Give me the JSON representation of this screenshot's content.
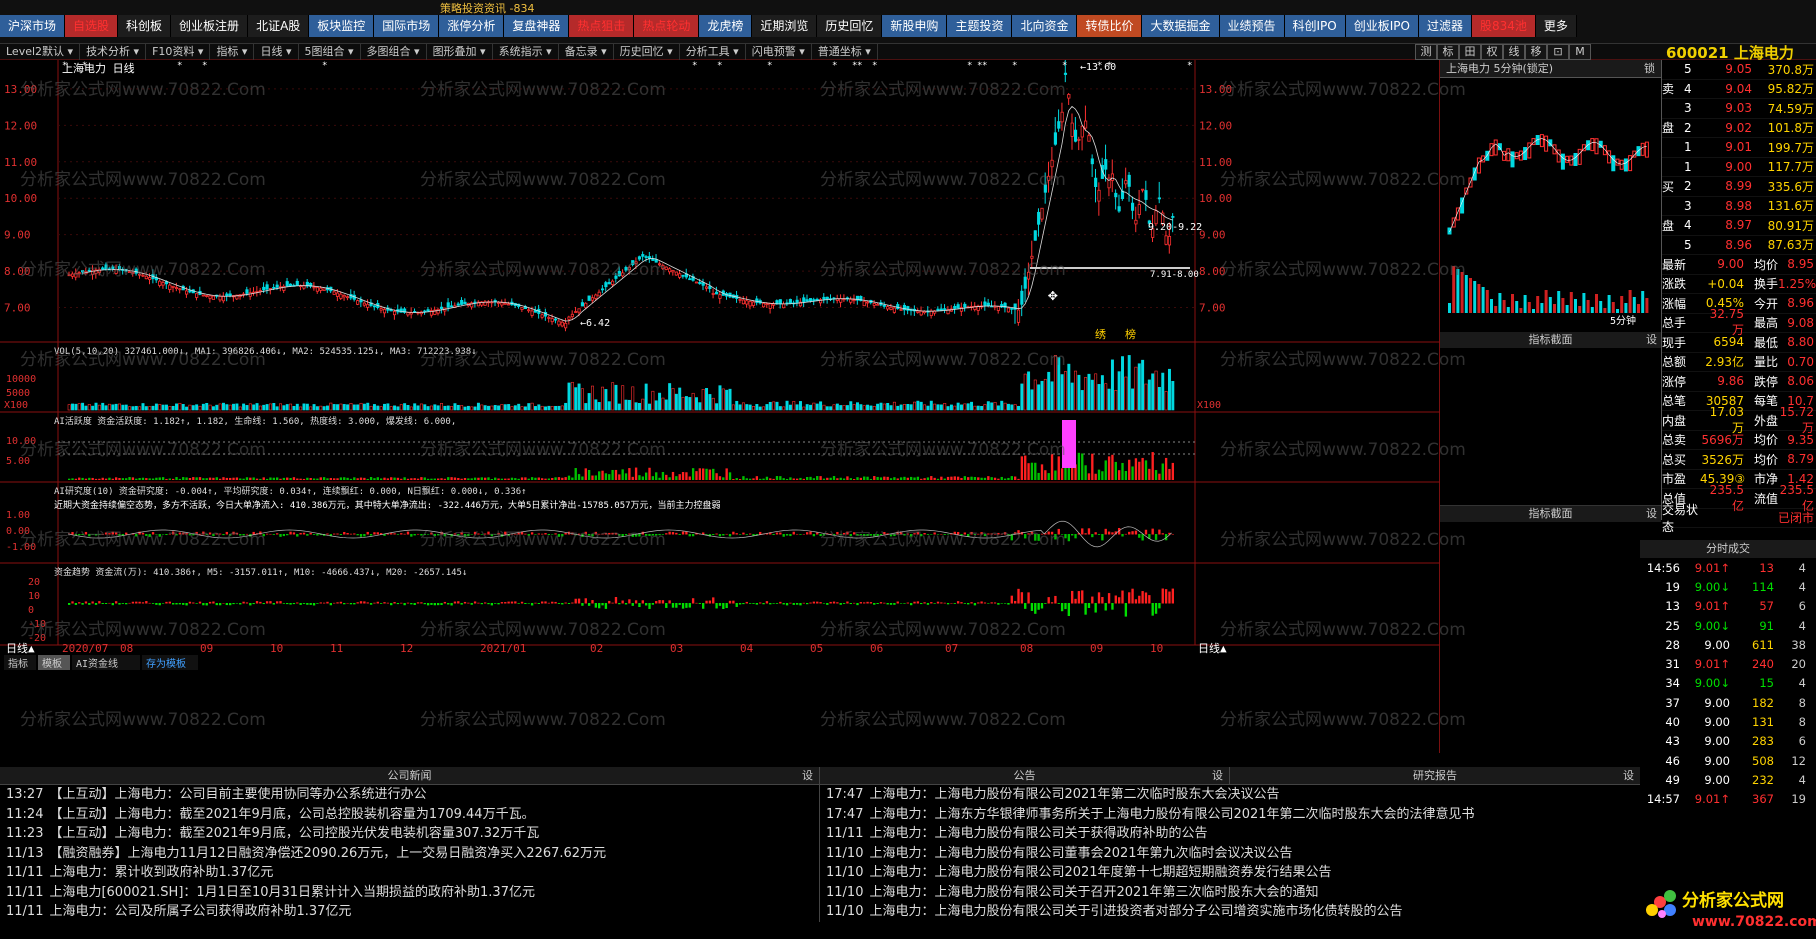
{
  "top": {
    "title_text": "策略投资资讯 -834",
    "menu": [
      "沪深市场",
      "自选股",
      "科创板",
      "创业板注册",
      "北证A股",
      "板块监控",
      "国际市场",
      "涨停分析",
      "复盘神器",
      "热点狙击",
      "热点轮动",
      "龙虎榜",
      "近期浏览",
      "历史回忆",
      "新股申购",
      "主题投资",
      "北向资金",
      "转债比价",
      "大数据掘金",
      "业绩预告",
      "科创IPO",
      "创业板IPO",
      "过滤器",
      "股834池",
      "更多"
    ]
  },
  "toolbar": [
    "Level2默认",
    "技术分析",
    "F10资料",
    "指标",
    "日线",
    "5图组合",
    "多图组合",
    "图形叠加",
    "系统指示",
    "备忘录",
    "历史回忆",
    "分析工具",
    "闪电预警",
    "普通坐标"
  ],
  "right_buttons": [
    "测",
    "标",
    "田",
    "权",
    "线",
    "移",
    "⊡",
    "M"
  ],
  "stock": {
    "code": "600021",
    "name": "上海电力"
  },
  "chart": {
    "title": "上海电力 日线",
    "price_high_label": "13.60",
    "price_low_label": "6.42",
    "last_label_1": "9.20-9.22",
    "last_label_2": "7.91-8.00",
    "y_ticks": [
      "13.00",
      "12.00",
      "11.00",
      "10.00",
      "9.00",
      "8.00",
      "7.00"
    ],
    "vol_line": "VOL(5,10,20)  327461.000↓, MA1: 396826.406↓, MA2: 524535.125↓, MA3: 712223.938↓",
    "vol_ticks": [
      "10000",
      "5000"
    ],
    "vol_unit": "X100",
    "ai1": "AI活跃度 资金活跃度: 1.182↑, 1.182, 生命线: 1.560, 热度线: 3.000, 爆发线: 6.000,",
    "ai1_ticks": [
      "10.00",
      "5.00"
    ],
    "ai2": "AI研究度(10) 资金研究度: -0.004↑, 平均研究度: 0.034↑, 连续飘红: 0.000, N日飘红: 0.000↓, 0.336↑",
    "ai2_note": "近期大资金持续偏空态势，多方不活跃，今日大单净流入: 410.386万元，其中特大单净流出: -322.446万元，大单5日累计净出-15785.057万元，当前主力控盘弱",
    "ai2_ticks": [
      "1.00",
      "0.00",
      "-1.00"
    ],
    "trend": "资金趋势 资金流(万): 410.386↑, M5: -3157.011↑, M10: -4666.437↓, M20: -2657.145↓",
    "trend_ticks": [
      "20",
      "10",
      "0",
      "-10",
      "-20"
    ],
    "x_labels": [
      "日线▲",
      "2020/07",
      "08",
      "09",
      "10",
      "11",
      "12",
      "2021/01",
      "02",
      "03",
      "04",
      "05",
      "06",
      "07",
      "08",
      "09",
      "10",
      "11"
    ],
    "bottom_tabs": [
      "指标",
      "模板",
      "AI资金线",
      "存为模板"
    ],
    "side_marks": [
      "绣",
      "榜"
    ]
  },
  "mini": {
    "title": "上海电力  5分钟(锁定)",
    "lock": "锁",
    "period": "5分钟",
    "indicator_tab": "指标截面",
    "set": "设"
  },
  "quote": {
    "sell": [
      [
        "5",
        "9.05",
        "370.8万"
      ],
      [
        "4",
        "9.04",
        "95.82万"
      ],
      [
        "3",
        "9.03",
        "74.59万"
      ],
      [
        "2",
        "9.02",
        "101.8万"
      ],
      [
        "1",
        "9.01",
        "199.7万"
      ]
    ],
    "buy": [
      [
        "1",
        "9.00",
        "117.7万"
      ],
      [
        "2",
        "8.99",
        "335.6万"
      ],
      [
        "3",
        "8.98",
        "131.6万"
      ],
      [
        "4",
        "8.97",
        "80.91万"
      ],
      [
        "5",
        "8.96",
        "87.63万"
      ]
    ],
    "sell_label": [
      "卖",
      "盘"
    ],
    "buy_label": [
      "买",
      "盘"
    ],
    "stats": [
      [
        "最新",
        "9.00",
        "均价",
        "8.95"
      ],
      [
        "涨跌",
        "+0.04",
        "换手",
        "1.25%"
      ],
      [
        "涨幅",
        "0.45%",
        "今开",
        "8.96"
      ],
      [
        "总手",
        "32.75万",
        "最高",
        "9.08"
      ],
      [
        "现手",
        "6594",
        "最低",
        "8.80"
      ],
      [
        "总额",
        "2.93亿",
        "量比",
        "0.70"
      ],
      [
        "涨停",
        "9.86",
        "跌停",
        "8.06"
      ],
      [
        "总笔",
        "30587",
        "每笔",
        "10.7"
      ],
      [
        "内盘",
        "17.03万",
        "外盘",
        "15.72万"
      ],
      [
        "总卖",
        "5696万",
        "均价",
        "9.35"
      ],
      [
        "总买",
        "3526万",
        "均价",
        "8.79"
      ],
      [
        "市盈",
        "45.39③",
        "市净",
        "1.42"
      ],
      [
        "总值",
        "235.5亿",
        "流值",
        "235.5亿"
      ],
      [
        "交易状态",
        "",
        "",
        "已闭市"
      ]
    ]
  },
  "ticks": {
    "header": "分时成交",
    "rows": [
      [
        "14:56",
        "9.01↑",
        "13",
        "4"
      ],
      [
        "19",
        "9.00↓",
        "114",
        "4"
      ],
      [
        "13",
        "9.01↑",
        "57",
        "6"
      ],
      [
        "25",
        "9.00↓",
        "91",
        "4"
      ],
      [
        "28",
        "9.00",
        "611",
        "38"
      ],
      [
        "31",
        "9.01↑",
        "240",
        "20"
      ],
      [
        "34",
        "9.00↓",
        "15",
        "4"
      ],
      [
        "37",
        "9.00",
        "182",
        "8"
      ],
      [
        "40",
        "9.00",
        "131",
        "8"
      ],
      [
        "43",
        "9.00",
        "283",
        "6"
      ],
      [
        "46",
        "9.00",
        "508",
        "12"
      ],
      [
        "49",
        "9.00",
        "232",
        "4"
      ],
      [
        "14:57",
        "9.01↑",
        "367",
        "19"
      ]
    ]
  },
  "news": {
    "company_title": "公司新闻",
    "notice_title": "公告",
    "report_title": "研究报告",
    "set": "设",
    "company": [
      [
        "13:27",
        "【上互动】上海电力：公司目前主要使用协同等办公系统进行办公"
      ],
      [
        "11:24",
        "【上互动】上海电力：截至2021年9月底，公司总控股装机容量为1709.44万千瓦。"
      ],
      [
        "11:23",
        "【上互动】上海电力：截至2021年9月底，公司控股光伏发电装机容量307.32万千瓦"
      ],
      [
        "11/13",
        "【融资融券】上海电力11月12日融资净偿还2090.26万元，上一交易日融资净买入2267.62万元"
      ],
      [
        "11/11",
        "上海电力：累计收到政府补助1.37亿元"
      ],
      [
        "11/11",
        "上海电力[600021.SH]：1月1日至10月31日累计计入当期损益的政府补助1.37亿元"
      ],
      [
        "11/11",
        "上海电力：公司及所属子公司获得政府补助1.37亿元"
      ]
    ],
    "notice": [
      [
        "17:47",
        "上海电力：上海电力股份有限公司2021年第二次临时股东大会决议公告"
      ],
      [
        "17:47",
        "上海电力：上海东方华银律师事务所关于上海电力股份有限公司2021年第二次临时股东大会的法律意见书"
      ],
      [
        "11/11",
        "上海电力：上海电力股份有限公司关于获得政府补助的公告"
      ],
      [
        "11/10",
        "上海电力：上海电力股份有限公司董事会2021年第九次临时会议决议公告"
      ],
      [
        "11/10",
        "上海电力：上海电力股份有限公司2021年度第十七期超短期融资券发行结果公告"
      ],
      [
        "11/10",
        "上海电力：上海电力股份有限公司关于召开2021年第三次临时股东大会的通知"
      ],
      [
        "11/10",
        "上海电力：上海电力股份有限公司关于引进投资者对部分子公司增资实施市场化债转股的公告"
      ]
    ]
  },
  "watermark": "分析家公式网www.70822.Com",
  "logo": {
    "text": "分析家公式网",
    "url": "www.70822.com"
  },
  "colors": {
    "up": "#ff3030",
    "down": "#00d8e0",
    "ma": "#ffffff",
    "accent": "#ffd400"
  }
}
